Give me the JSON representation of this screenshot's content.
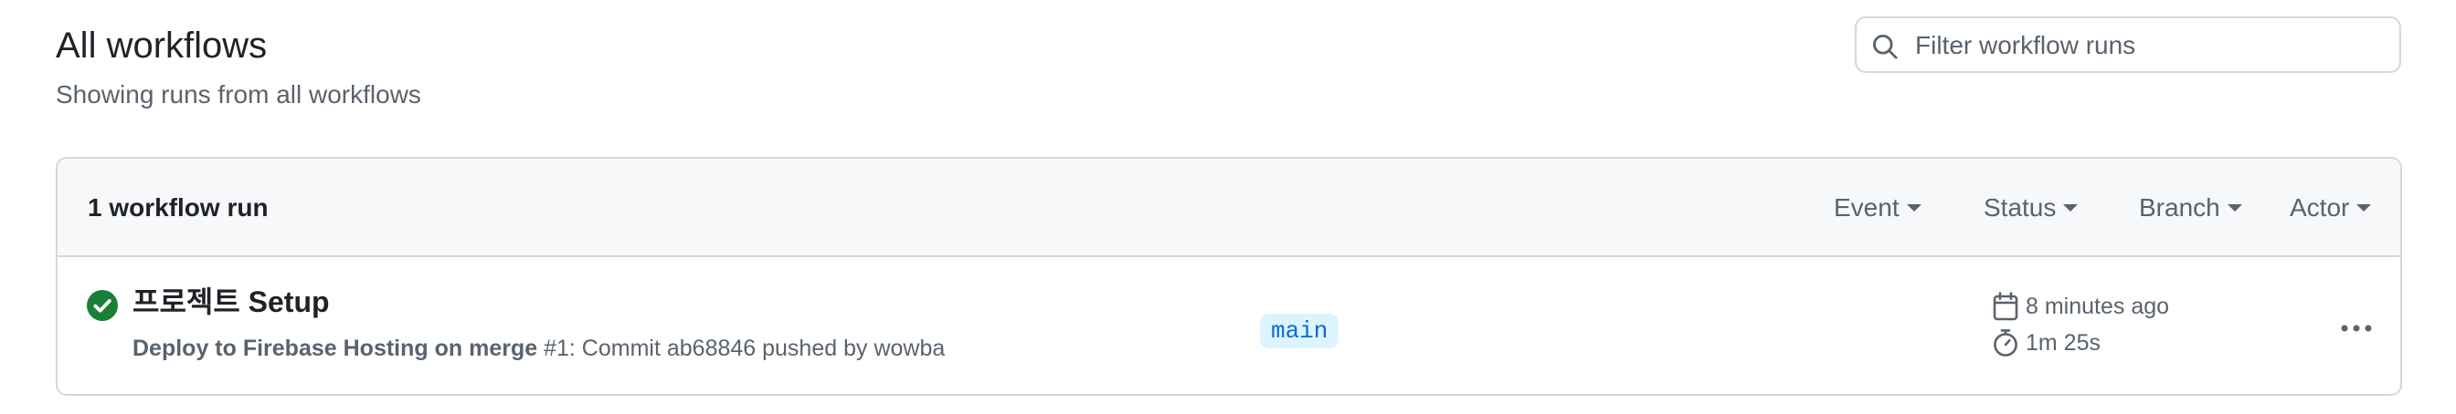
{
  "header": {
    "title": "All workflows",
    "subtitle": "Showing runs from all workflows"
  },
  "search": {
    "placeholder": "Filter workflow runs",
    "icon": "search-icon"
  },
  "runs_box": {
    "count_label": "1 workflow run",
    "filters": [
      "Event",
      "Status",
      "Branch",
      "Actor"
    ]
  },
  "runs": [
    {
      "status": "success",
      "status_color": "#1a7f37",
      "title": "프로젝트 Setup",
      "workflow_name": "Deploy to Firebase Hosting on merge",
      "run_number": "#1",
      "description": ": Commit ab68846 pushed by wowba",
      "branch": "main",
      "time_ago": "8 minutes ago",
      "duration": "1m 25s"
    }
  ],
  "colors": {
    "accent": "#0969da",
    "success": "#1a7f37",
    "muted_text": "#59636e",
    "border": "#d1d9e0"
  }
}
